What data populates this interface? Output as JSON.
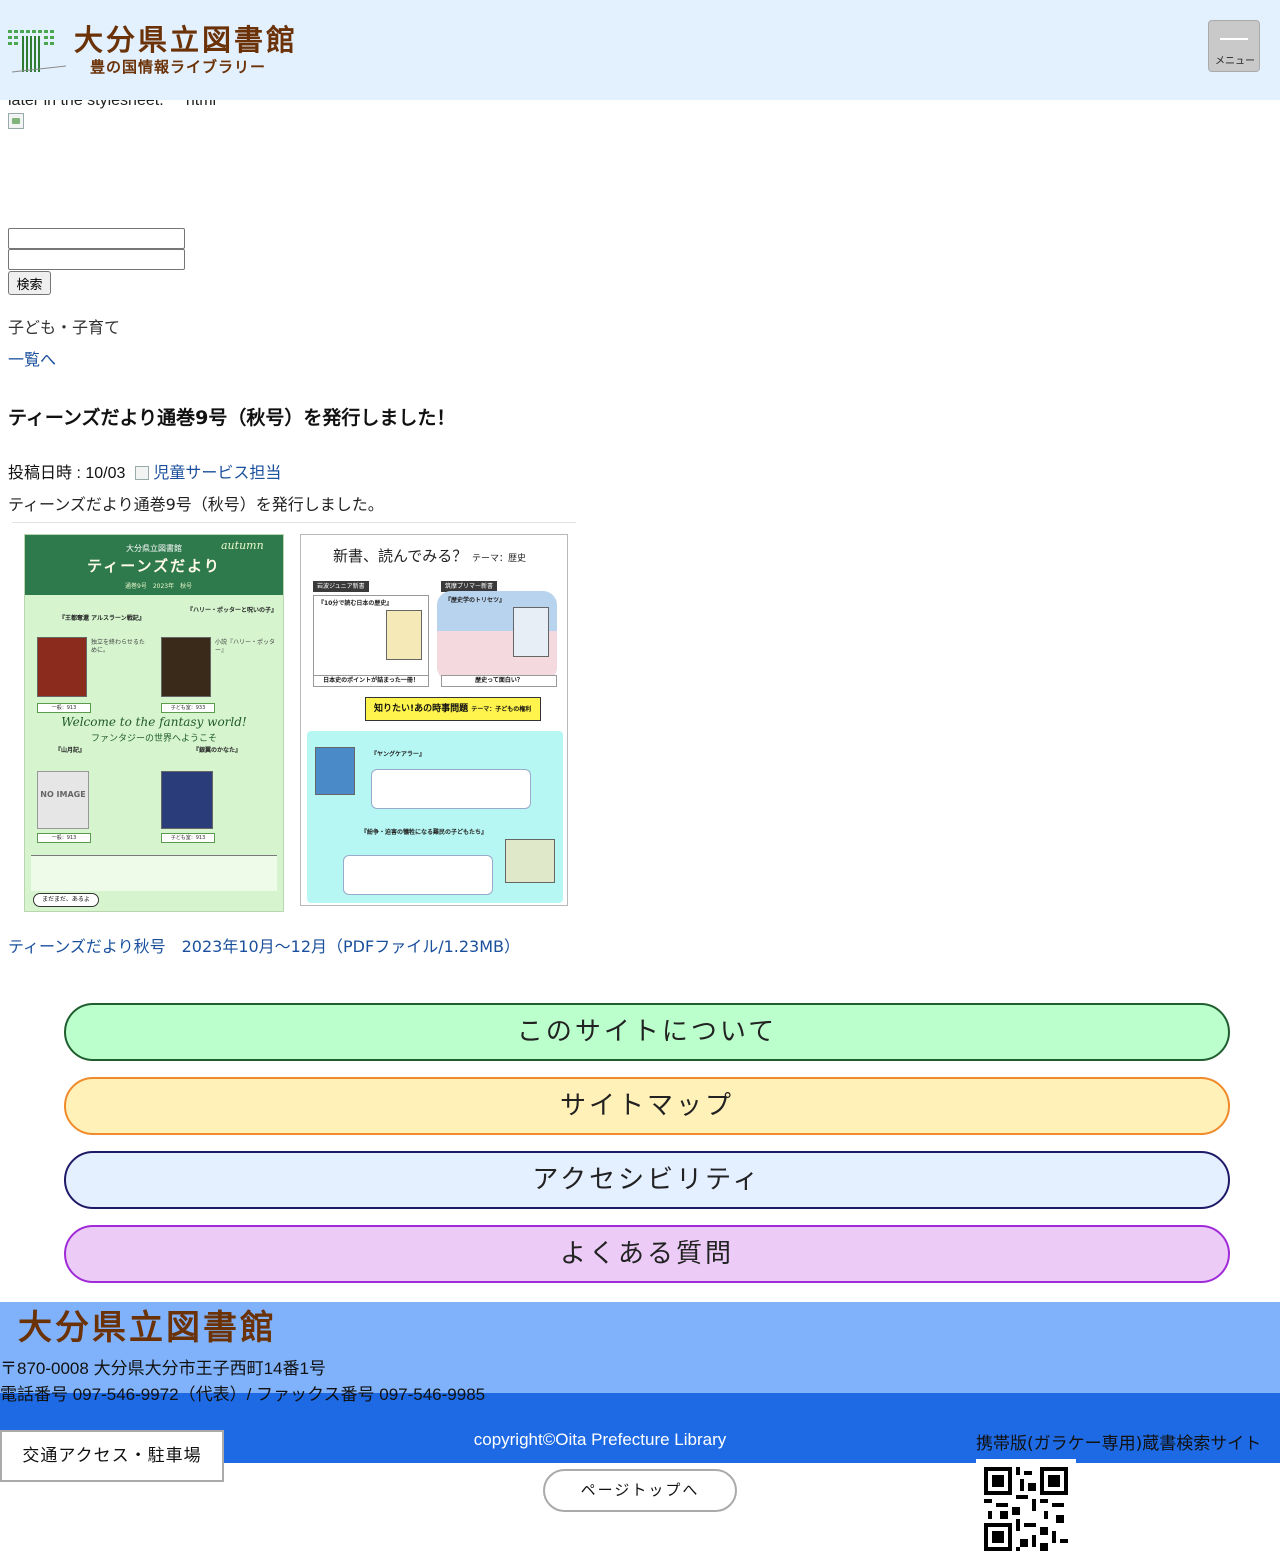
{
  "header": {
    "logo_title": "大分県立図書館",
    "logo_subtitle": "豊の国情報ライブラリー",
    "menu_label": "メニュー"
  },
  "stray_text": "later in the stylesheet.     html",
  "search": {
    "button_label": "検索"
  },
  "category": "子ども・子育て",
  "back_link": "一覧へ",
  "article": {
    "title": "ティーンズだより通巻9号（秋号）を発行しました！",
    "posted_label": "投稿日時 : 10/03",
    "author": "児童サービス担当",
    "intro": "ティーンズだより通巻9号（秋号）を発行しました。",
    "pdf_link_text": "ティーンズだより秋号　2023年10月～12月（PDFファイル/1.23MB）"
  },
  "newsletter": {
    "left_publisher": "大分県立図書館",
    "left_title": "ティーンズだより",
    "left_season": "autumn",
    "left_issue": "通巻9号　2023年　秋号",
    "book1": "『王都奪還 アルスラーン戦記』",
    "book2": "『ハリー・ポッターと呪いの子』",
    "book3": "『山月記』",
    "book4": "『銀翼のかなた』",
    "welcome_en": "Welcome to the fantasy world!",
    "welcome_jp": "ファンタジーの世界へようこそ",
    "no_image": "NO IMAGE",
    "mada_label": "まだまだ、あるよ",
    "right_heading": "新書、読んでみる？",
    "right_theme": "テーマ：歴史",
    "label_left": "岩波ジュニア新書",
    "label_right": "筑摩プリマー新書",
    "box_left_title": "『10分で読む日本の歴史』",
    "box_right_title": "『歴史学のトリセツ』",
    "btn_left": "日本史のポイントが詰まった一冊！",
    "btn_right": "歴史って面白い？",
    "banner": "知りたい!あの時事問題",
    "banner_theme": "テーマ：子どもの権利",
    "book5": "『ヤングケアラー』",
    "book6": "『紛争・迫害の犠牲になる難民の子どもたち』"
  },
  "footer_nav": [
    "このサイトについて",
    "サイトマップ",
    "アクセシビリティ",
    "よくある質問"
  ],
  "footer": {
    "logo": "大分県立図書館",
    "address": "〒870-0008 大分県大分市王子西町14番1号",
    "phone": "電話番号 097-546-9972（代表）/ ファックス番号 097-546-9985",
    "copyright": "copyright©Oita Prefecture Library",
    "access_button": "交通アクセス・駐車場",
    "mobile_site": "携帯版(ガラケー専用)蔵書検索サイト",
    "page_top": "ページトップへ"
  },
  "colors": {
    "header_bg": "#e3f0fd",
    "logo_brown": "#6b3208",
    "link_blue": "#1a4f9c",
    "footer_light": "#80b2fb",
    "footer_dark": "#1d6ae4"
  }
}
